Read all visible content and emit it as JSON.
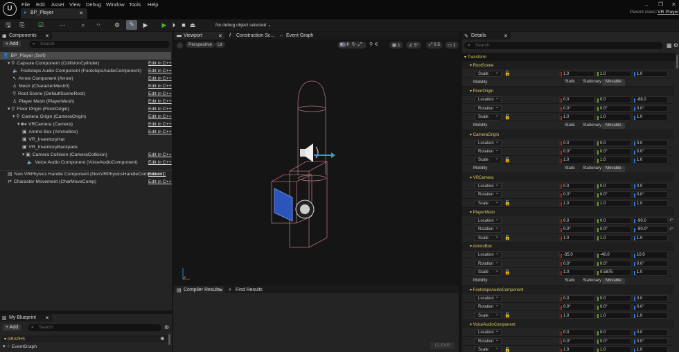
{
  "window": {
    "tab": "BP_Player",
    "parent_class_label": "Parent class:",
    "parent_class": "VR Player",
    "logo": "U"
  },
  "menu": [
    "File",
    "Edit",
    "Asset",
    "View",
    "Debug",
    "Window",
    "Tools",
    "Help"
  ],
  "toolbar": {
    "debug_select": "No debug object selected"
  },
  "components": {
    "title": "Components",
    "add": "+ Add",
    "search_placeholder": "Search",
    "items": [
      {
        "label": "BP_Player (Self)",
        "indent": 0,
        "edit": "",
        "icon": "👤"
      },
      {
        "label": "Capsule Component (CollisionCylinder)",
        "indent": 1,
        "edit": "Edit in C++",
        "icon": "▾ ⚲"
      },
      {
        "label": "Footsteps Audio Component (FootstepsAudioComponent)",
        "indent": 2,
        "edit": "Edit in C++",
        "icon": "🔈"
      },
      {
        "label": "Arrow Component (Arrow)",
        "indent": 2,
        "edit": "Edit in C++",
        "icon": "↖"
      },
      {
        "label": "Mesh (CharacterMesh0)",
        "indent": 2,
        "edit": "Edit in C++",
        "icon": "♙"
      },
      {
        "label": "Root Scene (DefaultSceneRoot)",
        "indent": 2,
        "edit": "Edit in C++",
        "icon": "⚲"
      },
      {
        "label": "Player Mesh (PlayerMesh)",
        "indent": 2,
        "edit": "Edit in C++",
        "icon": "♙"
      },
      {
        "label": "Floor Origin (FloorOrigin)",
        "indent": 1,
        "edit": "Edit in C++",
        "icon": "▾ ⚲"
      },
      {
        "label": "Camera Origin (CameraOrigin)",
        "indent": 2,
        "edit": "Edit in C++",
        "icon": "▾ ⚲"
      },
      {
        "label": "VRCamera (Camera)",
        "indent": 3,
        "edit": "Edit in C++",
        "icon": "▾ ■◂"
      },
      {
        "label": "Ammo Box (AmmoBox)",
        "indent": 4,
        "edit": "Edit in C++",
        "icon": "▣"
      },
      {
        "label": "VR_InventoryHat",
        "indent": 4,
        "edit": "",
        "icon": "▣"
      },
      {
        "label": "VR_InventoryBackpack",
        "indent": 4,
        "edit": "",
        "icon": "▣"
      },
      {
        "label": "Camera Collision (CameraCollision)",
        "indent": 4,
        "edit": "Edit in C++",
        "icon": "▾ ▣"
      },
      {
        "label": "Voice Audio Component (VoiceAudioComponent)",
        "indent": 5,
        "edit": "Edit in C++",
        "icon": "🔈"
      },
      {
        "label": "Non VRPhysics Handle Component (NonVRPhysicsHandleComponent)",
        "indent": 1,
        "edit": "Edit in C",
        "icon": "▤"
      },
      {
        "label": "Character Movement (CharMoveComp)",
        "indent": 1,
        "edit": "Edit in C++",
        "icon": "⇄"
      }
    ]
  },
  "viewport": {
    "tabs": [
      "Viewport",
      "Construction Sc...",
      "Event Graph"
    ],
    "perspective": "Perspective",
    "lit": "Lit",
    "grid": "1",
    "angle": "5°",
    "scale": "0.5",
    "camera_speed": "1"
  },
  "bottom": {
    "tabs": [
      "Compiler Results",
      "Find Results"
    ],
    "clear": "CLEAR"
  },
  "my_blueprint": {
    "title": "My Blueprint",
    "add": "+ Add",
    "search_placeholder": "Search",
    "graphs": "GRAPHS",
    "event_graph": "EventGraph"
  },
  "details": {
    "title": "Details",
    "search_placeholder": "Search",
    "transform": "Transform",
    "mobility_label": "Mobility",
    "mobility_options": [
      "Static",
      "Stationary",
      "Movable"
    ],
    "mobility_selected": "Movable",
    "sections": [
      {
        "name": "RootScene",
        "rows": [
          {
            "label": "Scale",
            "values": [
              "1.0",
              "1.0",
              "1.0"
            ]
          }
        ],
        "mobility": true
      },
      {
        "name": "FloorOrigin",
        "rows": [
          {
            "label": "Location",
            "values": [
              "0.0",
              "0.0",
              "-88.0"
            ]
          },
          {
            "label": "Rotation",
            "values": [
              "0.0°",
              "0.0°",
              "0.0°"
            ]
          },
          {
            "label": "Scale",
            "values": [
              "1.0",
              "1.0",
              "1.0"
            ]
          }
        ],
        "mobility": true
      },
      {
        "name": "CameraOrigin",
        "rows": [
          {
            "label": "Location",
            "values": [
              "0.0",
              "0.0",
              "0.0"
            ]
          },
          {
            "label": "Rotation",
            "values": [
              "0.0°",
              "0.0°",
              "0.0°"
            ]
          },
          {
            "label": "Scale",
            "values": [
              "1.0",
              "1.0",
              "1.0"
            ]
          }
        ],
        "mobility": true
      },
      {
        "name": "VRCamera",
        "rows": [
          {
            "label": "Location",
            "values": [
              "0.0",
              "0.0",
              "0.0"
            ]
          },
          {
            "label": "Rotation",
            "values": [
              "0.0°",
              "0.0°",
              "0.0°"
            ]
          },
          {
            "label": "Scale",
            "values": [
              "1.0",
              "1.0",
              "1.0"
            ]
          }
        ],
        "mobility": false
      },
      {
        "name": "PlayerMesh",
        "rows": [
          {
            "label": "Location",
            "values": [
              "0.0",
              "0.0",
              "-90.0"
            ],
            "reset": true
          },
          {
            "label": "Rotation",
            "values": [
              "0.0°",
              "0.0°",
              "-90.0°"
            ],
            "reset": true
          },
          {
            "label": "Scale",
            "values": [
              "1.0",
              "1.0",
              "1.0"
            ]
          }
        ],
        "mobility": false
      },
      {
        "name": "AmmoBox",
        "rows": [
          {
            "label": "Location",
            "values": [
              "-35.0",
              "-40.0",
              "10.0"
            ]
          },
          {
            "label": "Rotation",
            "values": [
              "0.0°",
              "0.0°",
              "0.0°"
            ]
          },
          {
            "label": "Scale",
            "values": [
              "1.0",
              "0.5875",
              "1.0"
            ]
          }
        ],
        "mobility": true
      },
      {
        "name": "FootstepsAudioComponent",
        "rows": [
          {
            "label": "Location",
            "values": [
              "0.0",
              "0.0",
              "0.0"
            ]
          },
          {
            "label": "Rotation",
            "values": [
              "0.0°",
              "0.0°",
              "0.0°"
            ]
          },
          {
            "label": "Scale",
            "values": [
              "1.0",
              "1.0",
              "1.0"
            ]
          }
        ],
        "mobility": false
      },
      {
        "name": "VoiceAudioComponent",
        "rows": [
          {
            "label": "Location",
            "values": [
              "0.0",
              "0.0",
              "0.0"
            ]
          },
          {
            "label": "Rotation",
            "values": [
              "0.0°",
              "0.0°",
              "0.0°"
            ]
          },
          {
            "label": "Scale",
            "values": [
              "1.0",
              "1.0",
              "1.0"
            ]
          }
        ],
        "mobility": false
      }
    ]
  },
  "colors": {
    "x": "#b3261e",
    "y": "#6aa31a",
    "z": "#2f7de0",
    "section": "#d8c76a",
    "play": "#4caf32"
  }
}
